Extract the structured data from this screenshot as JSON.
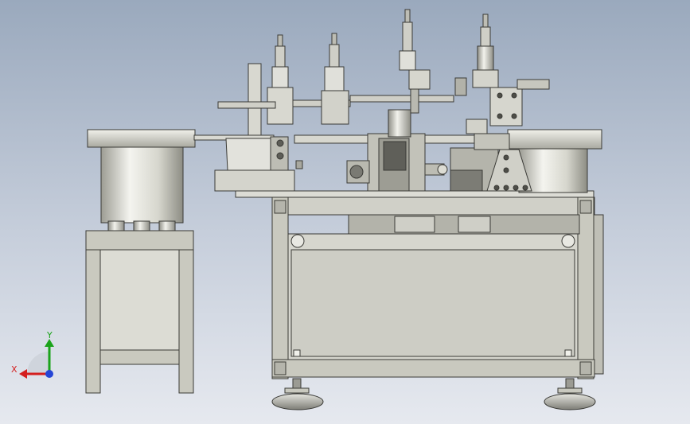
{
  "viewer": {
    "triad": {
      "x_label": "X",
      "y_label": "Y"
    },
    "colors": {
      "background_top": "#9aa9bd",
      "background_bottom": "#e6e9ef",
      "metal_light": "#e8e8e2",
      "metal_mid": "#c9c9bf",
      "metal_dark": "#8f8f86",
      "outline": "#3a3a36",
      "axis_x": "#d41f1f",
      "axis_y": "#1aa31a",
      "axis_z": "#2545d6"
    },
    "icons": [
      "coordinate-triad-icon"
    ]
  }
}
